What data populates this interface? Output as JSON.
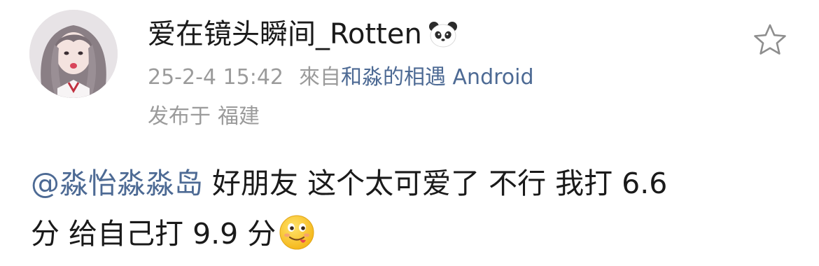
{
  "post": {
    "username": "爱在镜头瞬间_Rotten",
    "badge_icon": "panda-icon",
    "timestamp": "25-2-4 15:42",
    "from_label": "來自",
    "source": "和淼的相遇 Android",
    "location_prefix": "发布于",
    "location": "福建",
    "favorite_icon": "star-outline-icon",
    "mention": "@淼怡淼淼岛",
    "text_line1": " 好朋友 这个太可爱了 不行 我打 6.6",
    "text_line2": "分 给自己打 9.9 分",
    "emoji": "yum-face-emoji"
  },
  "colors": {
    "link": "#4d6a94",
    "meta_gray": "#9b9b9b",
    "text": "#1a1a1a"
  }
}
